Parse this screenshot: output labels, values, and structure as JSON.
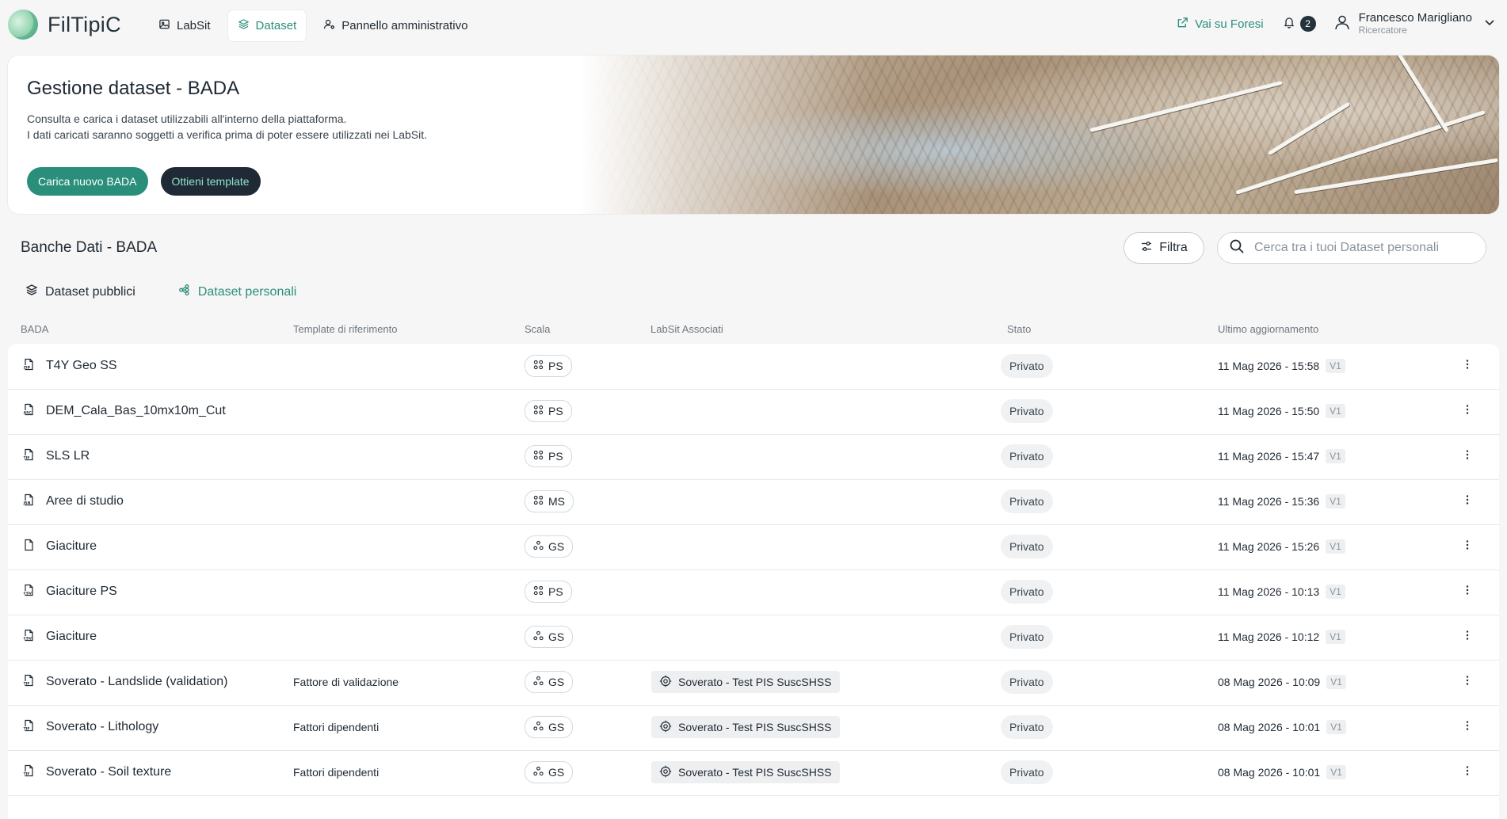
{
  "app": {
    "name": "FilTipiC"
  },
  "nav": [
    {
      "label": "LabSit",
      "icon": "image-icon",
      "active": false
    },
    {
      "label": "Dataset",
      "icon": "layers-icon",
      "active": true
    },
    {
      "label": "Pannello amministrativo",
      "icon": "user-gear-icon",
      "active": false
    }
  ],
  "header": {
    "external_link": "Vai su Foresi",
    "notification_count": "2",
    "user_name": "Francesco Marigliano",
    "user_role": "Ricercatore"
  },
  "hero": {
    "title": "Gestione dataset - BADA",
    "desc_line1": "Consulta e carica i dataset utilizzabili all'interno della piattaforma.",
    "desc_line2": "I dati caricati saranno soggetti a verifica prima di poter essere utilizzati nei LabSit.",
    "btn_upload": "Carica nuovo BADA",
    "btn_template": "Ottieni template"
  },
  "section": {
    "title": "Banche Dati - BADA",
    "filter_label": "Filtra",
    "search_placeholder": "Cerca tra i tuoi Dataset personali"
  },
  "tabs": [
    {
      "label": "Dataset pubblici",
      "active": false
    },
    {
      "label": "Dataset personali",
      "active": true
    }
  ],
  "table": {
    "columns": [
      "BADA",
      "Template di riferimento",
      "Scala",
      "LabSit Associati",
      "Stato",
      "Ultimo aggiornamento"
    ],
    "rows": [
      {
        "name": "T4Y Geo SS",
        "file_icon": "zip-file-icon",
        "template": "",
        "scala": "PS",
        "labsit": "",
        "stato": "Privato",
        "date": "11 Mag 2026 - 15:58",
        "version": "V1"
      },
      {
        "name": "DEM_Cala_Bas_10mx10m_Cut",
        "file_icon": "asc-file-icon",
        "template": "",
        "scala": "PS",
        "labsit": "",
        "stato": "Privato",
        "date": "11 Mag 2026 - 15:50",
        "version": "V1"
      },
      {
        "name": "SLS LR",
        "file_icon": "tif-file-icon",
        "template": "",
        "scala": "PS",
        "labsit": "",
        "stato": "Privato",
        "date": "11 Mag 2026 - 15:47",
        "version": "V1"
      },
      {
        "name": "Aree di studio",
        "file_icon": "json-file-icon",
        "template": "",
        "scala": "MS",
        "labsit": "",
        "stato": "Privato",
        "date": "11 Mag 2026 - 15:36",
        "version": "V1"
      },
      {
        "name": "Giaciture",
        "file_icon": "file-icon",
        "template": "",
        "scala": "GS",
        "labsit": "",
        "stato": "Privato",
        "date": "11 Mag 2026 - 15:26",
        "version": "V1"
      },
      {
        "name": "Giaciture PS",
        "file_icon": "csv-file-icon",
        "template": "",
        "scala": "PS",
        "labsit": "",
        "stato": "Privato",
        "date": "11 Mag 2026 - 10:13",
        "version": "V1"
      },
      {
        "name": "Giaciture",
        "file_icon": "csv-file-icon",
        "template": "",
        "scala": "GS",
        "labsit": "",
        "stato": "Privato",
        "date": "11 Mag 2026 - 10:12",
        "version": "V1"
      },
      {
        "name": "Soverato - Landslide (validation)",
        "file_icon": "tif-file-icon",
        "template": "Fattore di validazione",
        "scala": "GS",
        "labsit": "Soverato - Test PIS SuscSHSS",
        "stato": "Privato",
        "date": "08 Mag 2026 - 10:09",
        "version": "V1"
      },
      {
        "name": "Soverato - Lithology",
        "file_icon": "tif-file-icon",
        "template": "Fattori dipendenti",
        "scala": "GS",
        "labsit": "Soverato - Test PIS SuscSHSS",
        "stato": "Privato",
        "date": "08 Mag 2026 - 10:01",
        "version": "V1"
      },
      {
        "name": "Soverato - Soil texture",
        "file_icon": "tif-file-icon",
        "template": "Fattori dipendenti",
        "scala": "GS",
        "labsit": "Soverato - Test PIS SuscSHSS",
        "stato": "Privato",
        "date": "08 Mag 2026 - 10:01",
        "version": "V1"
      }
    ]
  },
  "colors": {
    "accent": "#2a8f7a",
    "dark_button": "#1f2a36",
    "background": "#f6f6f6"
  }
}
